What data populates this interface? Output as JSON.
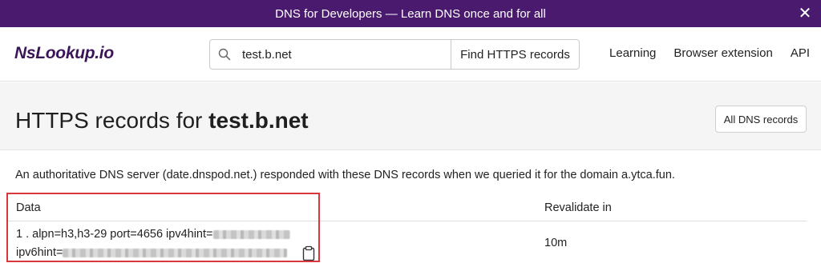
{
  "banner": {
    "text": "DNS for Developers — Learn DNS once and for all",
    "close_icon": "close-icon"
  },
  "nav": {
    "logo": "NsLookup.io",
    "search_value": "test.b.net",
    "search_button": "Find HTTPS records",
    "links": [
      "Learning",
      "Browser extension",
      "API"
    ]
  },
  "header": {
    "title_prefix": "HTTPS records for ",
    "title_domain": "test.b.net",
    "all_dns_button": "All DNS records"
  },
  "description": "An authoritative DNS server (date.dnspod.net.) responded with these DNS records when we queried it for the domain a.ytca.fun.",
  "table": {
    "headers": {
      "data": "Data",
      "revalidate": "Revalidate in"
    },
    "rows": [
      {
        "data_line1": "1 . alpn=h3,h3-29 port=4656 ipv4hint=",
        "data_line2": "ipv6hint=",
        "revalidate": "10m"
      }
    ]
  },
  "colors": {
    "banner_bg": "#4a1a6e",
    "logo": "#3a1658",
    "highlight": "#d9363e"
  }
}
